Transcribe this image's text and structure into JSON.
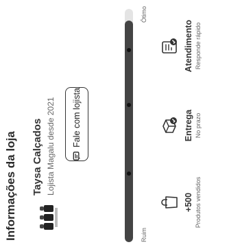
{
  "section": {
    "title": "Informações da loja"
  },
  "store": {
    "name": "Taysa Calçados",
    "since": "Lojista Magalu desde 2021"
  },
  "actions": {
    "contact_label": "Fale com lojista"
  },
  "reputation": {
    "level_fraction": 0.95,
    "min_label": "Ruim",
    "max_label": "Ótimo"
  },
  "metrics": [
    {
      "icon": "shopping-bag-icon",
      "value": "+500",
      "caption": "Produtos vendidos"
    },
    {
      "icon": "delivery-box-icon",
      "value": "Entrega",
      "caption": "No prazo"
    },
    {
      "icon": "support-check-icon",
      "value": "Atendimento",
      "caption": "Responde rápido"
    }
  ],
  "colors": {
    "bar_fill": "#444444",
    "bar_track": "#e4e4e4",
    "text": "#222222"
  }
}
